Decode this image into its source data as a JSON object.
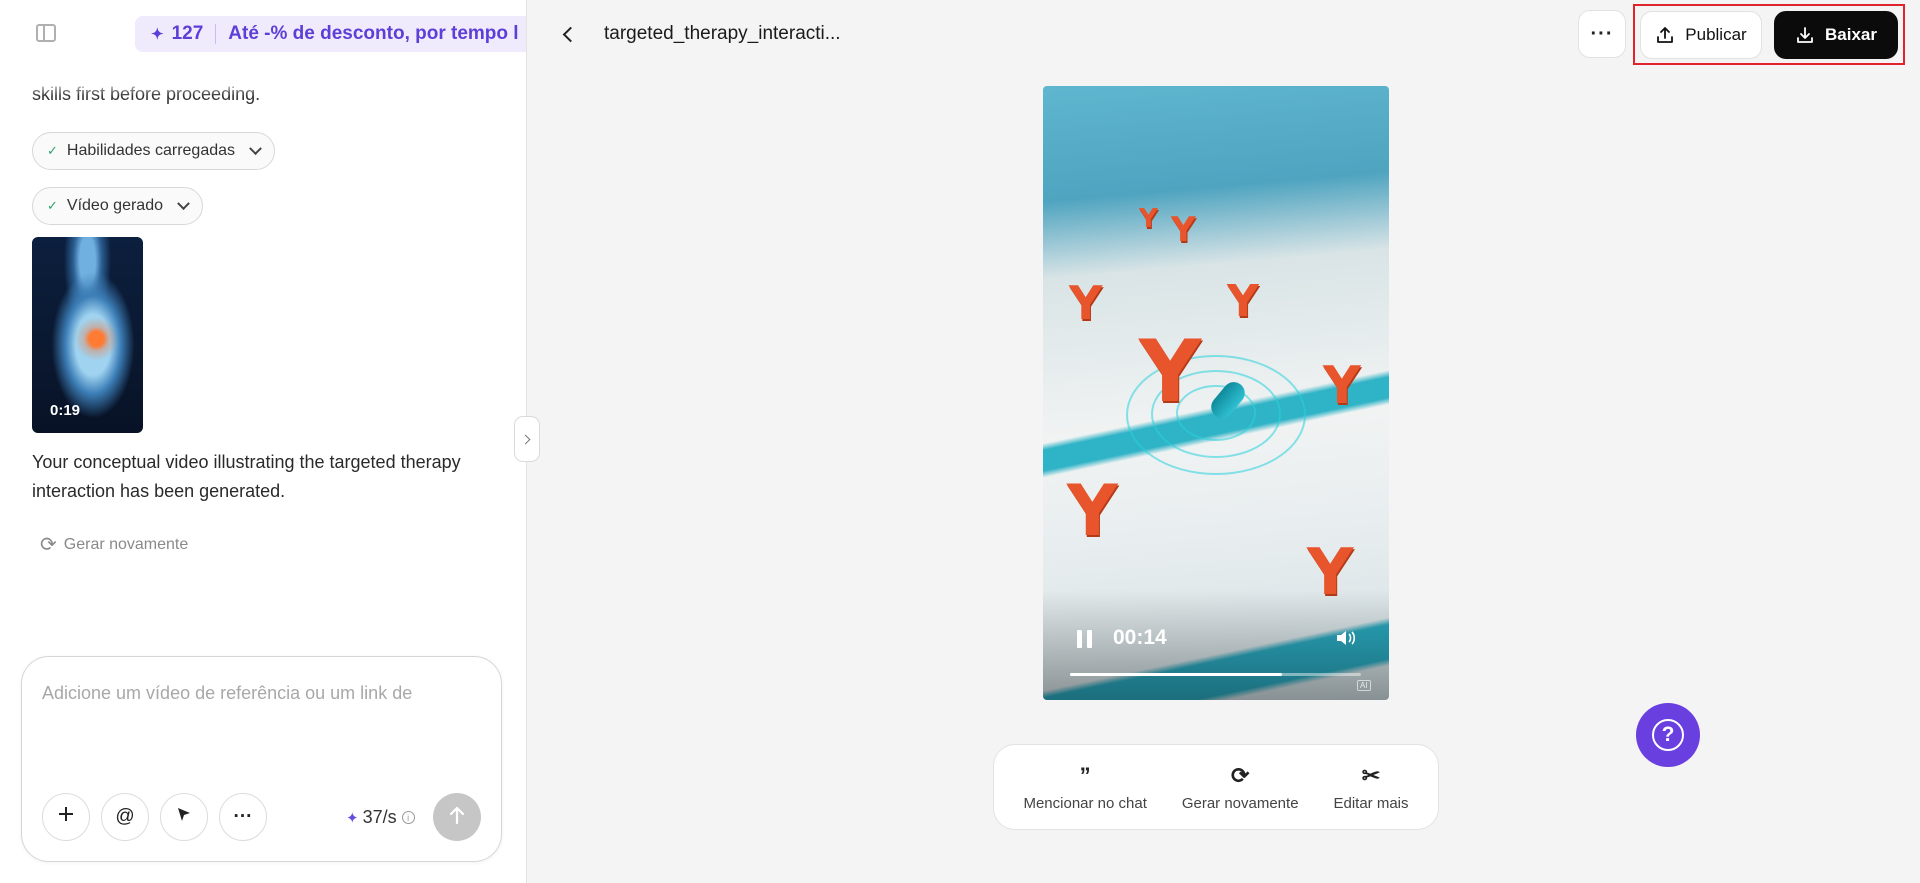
{
  "sidebar": {
    "toggle_icon": "sidebar-toggle-icon"
  },
  "promo": {
    "credits": "127",
    "text": "Até -% de desconto, por tempo l",
    "accent": "#5b3fd6"
  },
  "chat": {
    "truncated_text": "skills first before proceeding.",
    "steps": [
      {
        "label": "Habilidades carregadas",
        "status": "done"
      },
      {
        "label": "Vídeo gerado",
        "status": "done"
      }
    ],
    "thumbnail": {
      "duration": "0:19"
    },
    "message": "Your conceptual video illustrating the targeted therapy interaction has been generated.",
    "regenerate_label": "Gerar novamente"
  },
  "composer": {
    "placeholder": "Adicione um vídeo de referência ou um link de",
    "value": "",
    "credits": "37/s",
    "info_glyph": "i"
  },
  "header": {
    "title": "targeted_therapy_interacti...",
    "more_glyph": "···",
    "publish_label": "Publicar",
    "download_label": "Baixar",
    "highlight_color": "#e0232c"
  },
  "player": {
    "current_time": "00:14",
    "progress": 0.73,
    "ai_mark": "AI"
  },
  "actions": [
    {
      "label": "Mencionar no chat",
      "icon": "quote-icon"
    },
    {
      "label": "Gerar novamente",
      "icon": "refresh-icon"
    },
    {
      "label": "Editar mais",
      "icon": "scissors-icon"
    }
  ],
  "help": {
    "glyph": "?",
    "color": "#6a3fe0"
  }
}
